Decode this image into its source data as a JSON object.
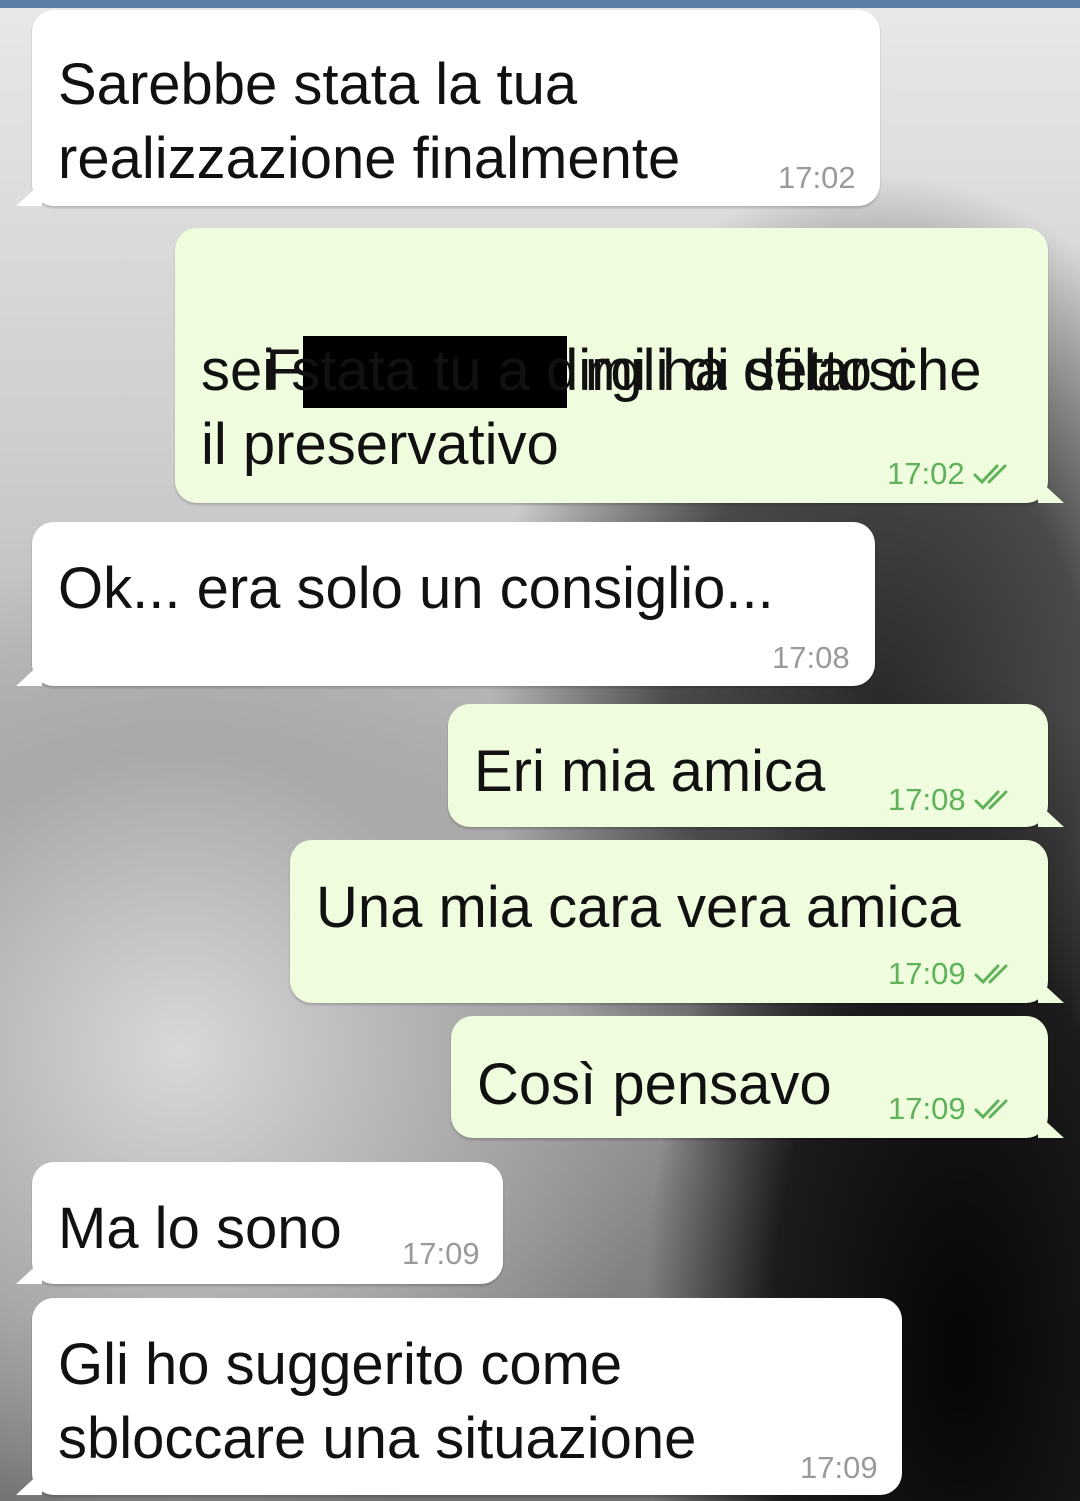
{
  "messages": [
    {
      "direction": "incoming",
      "lines": [
        "Sarebbe stata la tua",
        "realizzazione finalmente"
      ],
      "time": "17:02"
    },
    {
      "direction": "outgoing",
      "line1_start": "F",
      "line1_end": "mi ha detto che",
      "lines": [
        "sei stata tu a dirgli di sfilarsi",
        "il preservativo"
      ],
      "time": "17:02",
      "status_icon": "double-check-icon"
    },
    {
      "direction": "incoming",
      "lines": [
        "Ok... era solo un consiglio..."
      ],
      "time": "17:08"
    },
    {
      "direction": "outgoing",
      "lines": [
        "Eri mia amica"
      ],
      "time": "17:08",
      "status_icon": "double-check-icon"
    },
    {
      "direction": "outgoing",
      "lines": [
        "Una mia cara vera amica"
      ],
      "time": "17:09",
      "status_icon": "double-check-icon"
    },
    {
      "direction": "outgoing",
      "lines": [
        "Così pensavo"
      ],
      "time": "17:09",
      "status_icon": "double-check-icon"
    },
    {
      "direction": "incoming",
      "lines": [
        "Ma lo sono"
      ],
      "time": "17:09"
    },
    {
      "direction": "incoming",
      "lines": [
        "Gli ho suggerito come",
        "sbloccare una situazione"
      ],
      "time": "17:09"
    }
  ],
  "colors": {
    "incoming_bubble": "#ffffff",
    "outgoing_bubble": "#effdde",
    "incoming_time": "#9a9a9a",
    "outgoing_time": "#5fb25a",
    "top_bar": "#5b7fa6"
  }
}
